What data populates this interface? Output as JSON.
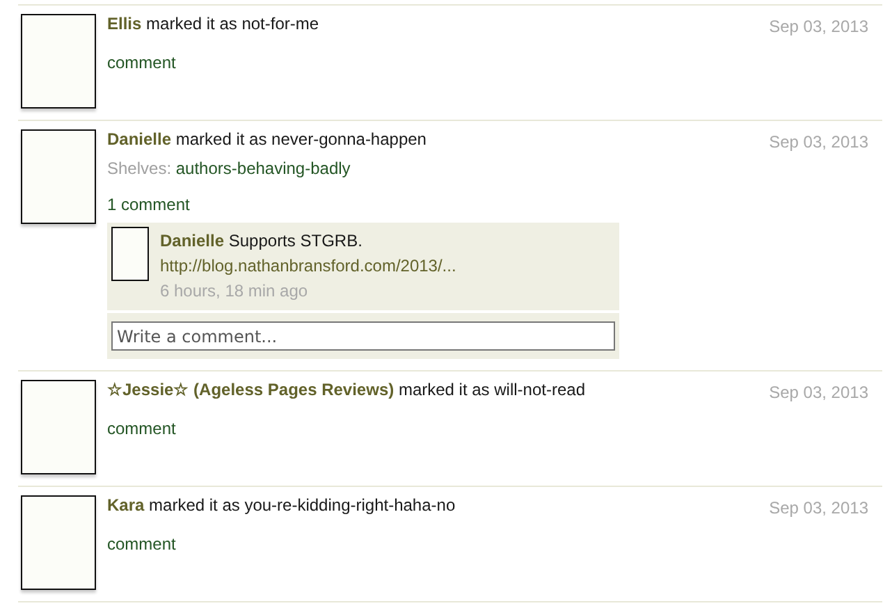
{
  "activity": [
    {
      "user": "Ellis",
      "action": "marked it as not-for-me",
      "date": "Sep 03, 2013",
      "comment_link": "comment"
    },
    {
      "user": "Danielle",
      "action": "marked it as never-gonna-happen",
      "date": "Sep 03, 2013",
      "shelves_label": "Shelves:",
      "shelves": "authors-behaving-badly",
      "comment_link": "1 comment",
      "comments": [
        {
          "user": "Danielle",
          "text": "Supports STGRB.",
          "link": "http://blog.nathanbransford.com/2013/...",
          "time": "6 hours, 18 min ago"
        }
      ],
      "comment_field": {
        "placeholder": "Write a comment..."
      }
    },
    {
      "user": "☆Jessie☆ (Ageless Pages Reviews)",
      "action": "marked it as will-not-read",
      "date": "Sep 03, 2013",
      "comment_link": "comment"
    },
    {
      "user": "Kara",
      "action": "marked it as you-re-kidding-right-haha-no",
      "date": "Sep 03, 2013",
      "comment_link": "comment"
    }
  ]
}
